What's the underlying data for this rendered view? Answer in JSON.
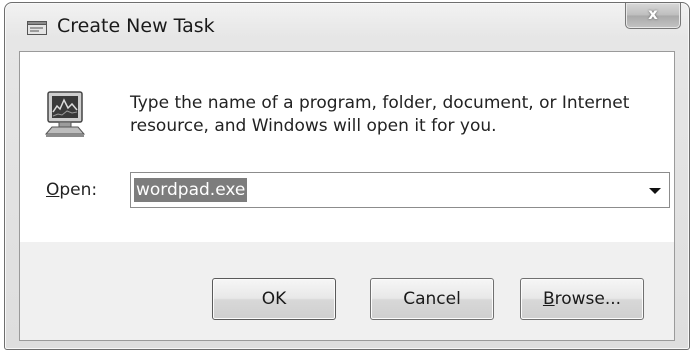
{
  "window": {
    "title": "Create New Task",
    "close_glyph": "x"
  },
  "dialog": {
    "message": "Type the name of a program, folder, document, or Internet resource, and Windows will open it for you.",
    "open_label_accel": "O",
    "open_label_rest": "pen:",
    "open_value": "wordpad.exe",
    "icons": {
      "title": "run-dialog-icon",
      "app": "task-manager-icon",
      "dropdown": "chevron-down-icon"
    }
  },
  "buttons": {
    "ok": "OK",
    "cancel": "Cancel",
    "browse_accel": "B",
    "browse_rest": "rowse..."
  }
}
